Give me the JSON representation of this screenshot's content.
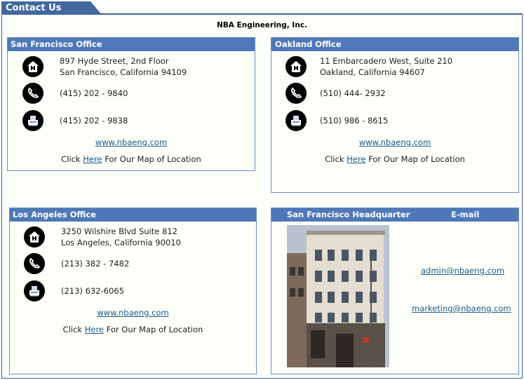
{
  "page": {
    "title": "Contact Us",
    "company": "NBA Engineering, Inc."
  },
  "offices": {
    "sf": {
      "name": "San Francisco Office",
      "address_line1": "897 Hyde Street, 2nd Floor",
      "address_line2": "San Francisco, California 94109",
      "phone": "(415) 202 - 9840",
      "fax": "(415) 202 - 9838",
      "website": "www.nbaeng.com",
      "map_prefix": "Click ",
      "map_link": "Here",
      "map_suffix": " For Our Map of Location"
    },
    "oak": {
      "name": "Oakland Office",
      "address_line1": "11 Embarcadero West, Suite 210",
      "address_line2": "Oakland, California 94607",
      "phone": "(510) 444- 2932",
      "fax": "(510) 986 - 8615",
      "website": "www.nbaeng.com",
      "map_prefix": "Click ",
      "map_link": "Here",
      "map_suffix": " For Our Map of Location"
    },
    "la": {
      "name": "Los Angeles Office",
      "address_line1": "3250 Wilshire Blvd Suite 812",
      "address_line2": "Los Angeles, California 90010",
      "phone": "(213) 382 - 7482",
      "fax": "(213) 632-6065",
      "website": "www.nbaeng.com",
      "map_prefix": "Click ",
      "map_link": "Here",
      "map_suffix": " For Our Map of Location"
    }
  },
  "hq": {
    "heading": "San Francisco Headquarter",
    "email_heading": "E-mail",
    "emails": [
      "admin@nbaeng.com",
      "marketing@nbaeng.com"
    ]
  },
  "icons": {
    "address": "building-icon",
    "phone": "phone-icon",
    "fax": "fax-icon"
  },
  "colors": {
    "header": "#41689f",
    "panel_header": "#4e78b7",
    "link": "#1c5a8c"
  }
}
